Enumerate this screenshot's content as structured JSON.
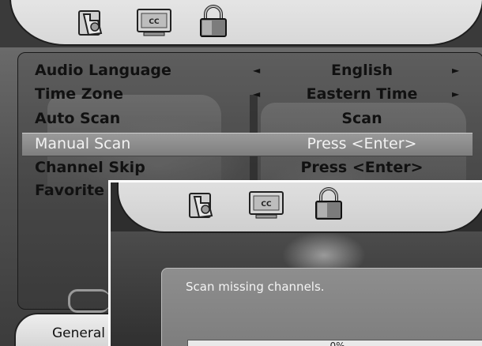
{
  "back_screen": {
    "tabs": [
      {
        "name": "general-tab",
        "icon": "hand-pointer-icon"
      },
      {
        "name": "caption-tab",
        "icon": "cc-icon",
        "text": "CC"
      },
      {
        "name": "lock-tab",
        "icon": "padlock-icon"
      }
    ],
    "menu": [
      {
        "label": "Audio Language",
        "value": "English",
        "arrows": true
      },
      {
        "label": "Time Zone",
        "value": "Eastern Time",
        "arrows": true
      },
      {
        "label": "Auto Scan",
        "value": "Scan",
        "arrows": false
      },
      {
        "label": "Manual Scan",
        "value": "Press <Enter>",
        "arrows": false,
        "selected": true
      },
      {
        "label": "Channel Skip",
        "value": "Press <Enter>",
        "arrows": false
      },
      {
        "label": "Favorite L",
        "value": "",
        "arrows": false
      }
    ],
    "arrow_left": "◄",
    "arrow_right": "►",
    "bottom_tab_label": "General"
  },
  "front_screen": {
    "tabs": [
      {
        "name": "general-tab",
        "icon": "hand-pointer-icon"
      },
      {
        "name": "caption-tab",
        "icon": "cc-icon",
        "text": "CC"
      },
      {
        "name": "lock-tab",
        "icon": "padlock-icon"
      }
    ],
    "dialog_message": "Scan missing channels.",
    "progress_label": "0%",
    "progress_value": 0
  }
}
